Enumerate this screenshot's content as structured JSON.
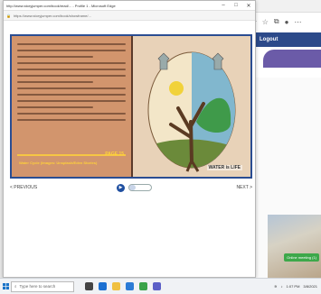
{
  "popup": {
    "title": "http://www.storyjumper.com/book/read/... - Profile 1 - Microsoft Edge",
    "url": "https://www.storyjumper.com/book/showframe/...",
    "window_controls": [
      "–",
      "□",
      "✕"
    ]
  },
  "book": {
    "caption": "Water Cycle (Images: Unsplash/Eden Stories)",
    "page_number": "PAGE 15",
    "title_label": "WATER is LIFE"
  },
  "controls": {
    "left_label": "< PREVIOUS",
    "right_label": "NEXT >",
    "progress_fraction": 0.3
  },
  "background_window": {
    "nav_label": "Logout",
    "meeting_badge": "Online meeting (1)"
  },
  "taskbar": {
    "search_placeholder": "Type here to search",
    "time": "1:07 PM",
    "date": "3/8/2021"
  },
  "colors": {
    "viewer_frame": "#2a4d92",
    "page_left": "#d2956d",
    "page_right": "#e8d2b8",
    "caption_yellow": "#ffd23a",
    "play_button": "#1f4fa0"
  }
}
